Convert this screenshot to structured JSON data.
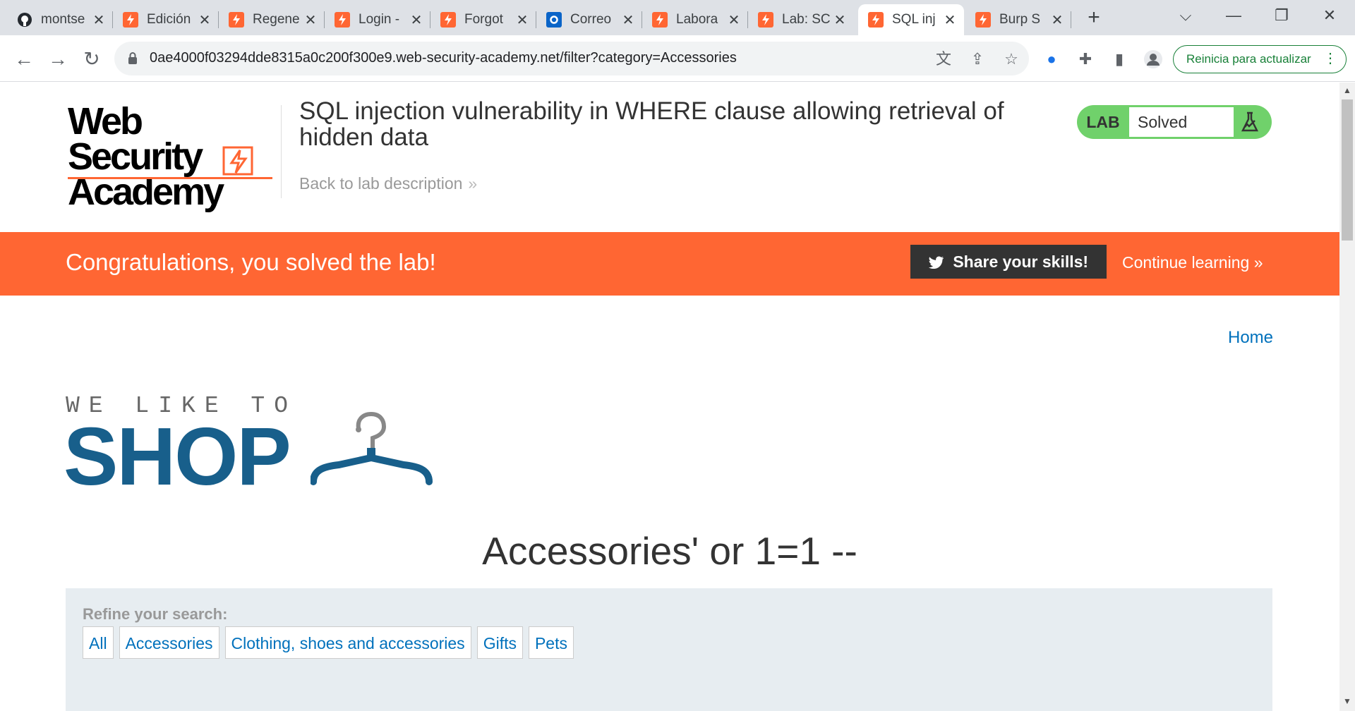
{
  "browser": {
    "tabs": [
      {
        "title": "montse",
        "icon": "github-icon"
      },
      {
        "title": "Edición",
        "icon": "burp-icon"
      },
      {
        "title": "Regene",
        "icon": "burp-icon"
      },
      {
        "title": "Login -",
        "icon": "burp-icon"
      },
      {
        "title": "Forgot",
        "icon": "burp-icon"
      },
      {
        "title": "Correo",
        "icon": "outlook-icon"
      },
      {
        "title": "Labora",
        "icon": "burp-icon"
      },
      {
        "title": "Lab: SC",
        "icon": "burp-icon"
      },
      {
        "title": "SQL inj",
        "icon": "burp-icon",
        "active": true
      },
      {
        "title": "Burp S",
        "icon": "burp-icon"
      }
    ],
    "url": "0ae4000f03294dde8315a0c200f300e9.web-security-academy.net/filter?category=Accessories",
    "update_button": "Reinicia para actualizar"
  },
  "header": {
    "logo_line1": "Web Security",
    "logo_line2": "Academy",
    "lab_title": "SQL injection vulnerability in WHERE clause allowing retrieval of hidden data",
    "back_link": "Back to lab description",
    "status_label": "LAB",
    "status_value": "Solved"
  },
  "banner": {
    "message": "Congratulations, you solved the lab!",
    "share_button": "Share your skills!",
    "continue_link": "Continue learning"
  },
  "nav": {
    "home": "Home"
  },
  "shop_logo": {
    "small": "WE LIKE TO",
    "big": "SHOP"
  },
  "category_heading": "Accessories' or 1=1 --",
  "refine": {
    "label": "Refine your search:",
    "filters": [
      "All",
      "Accessories",
      "Clothing, shoes and accessories",
      "Gifts",
      "Pets"
    ]
  },
  "colors": {
    "accent": "#ff6633",
    "link": "#0071bc",
    "shop_blue": "#185f8b",
    "solved_green": "#70d16b"
  }
}
